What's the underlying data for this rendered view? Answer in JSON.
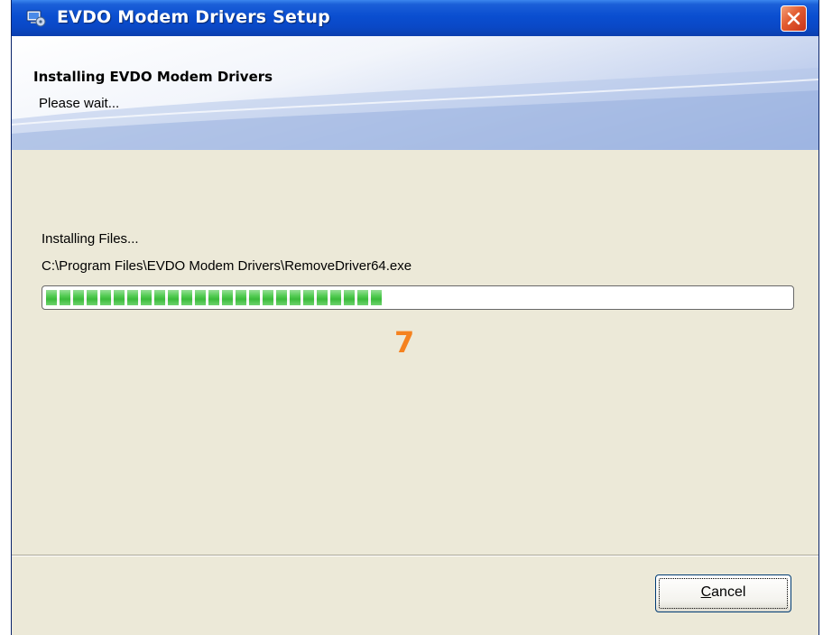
{
  "window": {
    "title": "EVDO Modem Drivers Setup"
  },
  "header": {
    "title": "Installing EVDO Modem Drivers",
    "subtitle": "Please wait..."
  },
  "status": {
    "text": "Installing Files...",
    "file_path": "C:\\Program Files\\EVDO Modem Drivers\\RemoveDriver64.exe",
    "progress_percent": 46
  },
  "annotation": {
    "step": "7"
  },
  "buttons": {
    "cancel_mnemonic": "C",
    "cancel_rest": "ancel"
  },
  "colors": {
    "titlebar": "#0a4ed0",
    "progress_fill": "#3ec53e",
    "step_number": "#f5821f",
    "dialog_bg": "#ece9d8"
  },
  "icons": {
    "app": "setup-computer-icon",
    "close": "close-icon"
  }
}
